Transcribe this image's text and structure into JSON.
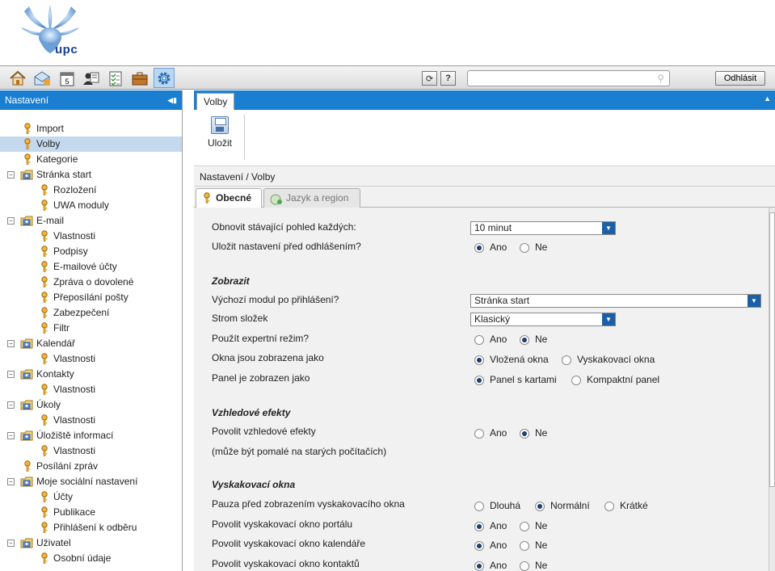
{
  "brand": {
    "logo_text": "upc"
  },
  "toolbar": {
    "icons": [
      "home-icon",
      "mail-icon",
      "calendar-icon",
      "contacts-icon",
      "tasks-icon",
      "briefcase-icon",
      "settings-gear-icon"
    ],
    "calendar_day": "5",
    "refresh_symbol": "⟳",
    "help_symbol": "?",
    "search_placeholder": "",
    "logout_label": "Odhlásit"
  },
  "sidebar": {
    "title": "Nastavení",
    "items": [
      {
        "label": "Import",
        "icon": "key-icon",
        "level": 0
      },
      {
        "label": "Volby",
        "icon": "key-icon",
        "level": 0,
        "selected": true
      },
      {
        "label": "Kategorie",
        "icon": "key-icon",
        "level": 0
      },
      {
        "label": "Stránka start",
        "icon": "folder-icon",
        "level": 0,
        "expanded": true
      },
      {
        "label": "Rozložení",
        "icon": "key-icon",
        "level": 1
      },
      {
        "label": "UWA moduly",
        "icon": "key-icon",
        "level": 1
      },
      {
        "label": "E-mail",
        "icon": "folder-icon",
        "level": 0,
        "expanded": true
      },
      {
        "label": "Vlastnosti",
        "icon": "key-icon",
        "level": 1
      },
      {
        "label": "Podpisy",
        "icon": "key-icon",
        "level": 1
      },
      {
        "label": "E-mailové účty",
        "icon": "key-icon",
        "level": 1
      },
      {
        "label": "Zpráva o dovolené",
        "icon": "key-icon",
        "level": 1
      },
      {
        "label": "Přeposílání pošty",
        "icon": "key-icon",
        "level": 1
      },
      {
        "label": "Zabezpečení",
        "icon": "key-icon",
        "level": 1
      },
      {
        "label": "Filtr",
        "icon": "key-icon",
        "level": 1
      },
      {
        "label": "Kalendář",
        "icon": "folder-icon",
        "level": 0,
        "expanded": true
      },
      {
        "label": "Vlastnosti",
        "icon": "key-icon",
        "level": 1
      },
      {
        "label": "Kontakty",
        "icon": "folder-icon",
        "level": 0,
        "expanded": true
      },
      {
        "label": "Vlastnosti",
        "icon": "key-icon",
        "level": 1
      },
      {
        "label": "Úkoly",
        "icon": "folder-icon",
        "level": 0,
        "expanded": true
      },
      {
        "label": "Vlastnosti",
        "icon": "key-icon",
        "level": 1
      },
      {
        "label": "Úložiště informací",
        "icon": "folder-icon",
        "level": 0,
        "expanded": true
      },
      {
        "label": "Vlastnosti",
        "icon": "key-icon",
        "level": 1
      },
      {
        "label": "Posílání zpráv",
        "icon": "key-icon",
        "level": 0
      },
      {
        "label": "Moje sociální nastavení",
        "icon": "folder-icon",
        "level": 0,
        "expanded": true
      },
      {
        "label": "Účty",
        "icon": "key-icon",
        "level": 1
      },
      {
        "label": "Publikace",
        "icon": "key-icon",
        "level": 1
      },
      {
        "label": "Přihlášení k odběru",
        "icon": "key-icon",
        "level": 1
      },
      {
        "label": "Uživatel",
        "icon": "folder-icon",
        "level": 0,
        "expanded": true
      },
      {
        "label": "Osobní údaje",
        "icon": "key-icon",
        "level": 1
      }
    ]
  },
  "main": {
    "tab_label": "Volby",
    "save_label": "Uložit",
    "breadcrumb": "Nastavení / Volby",
    "subtabs": {
      "general": "Obecné",
      "language": "Jazyk a region"
    },
    "form": {
      "refresh_label": "Obnovit stávající pohled každých:",
      "refresh_value": "10 minut",
      "save_settings_label": "Uložit nastavení před odhlášením?",
      "yes": "Ano",
      "no": "Ne",
      "section_display": "Zobrazit",
      "default_module_label": "Výchozí modul po přihlášení?",
      "default_module_value": "Stránka start",
      "folder_tree_label": "Strom složek",
      "folder_tree_value": "Klasický",
      "expert_mode_label": "Použít expertní režim?",
      "windows_label": "Okna jsou zobrazena jako",
      "windows_embedded": "Vložená okna",
      "windows_popup": "Vyskakovací okna",
      "panel_label": "Panel je zobrazen jako",
      "panel_tabs": "Panel s kartami",
      "panel_compact": "Kompaktní panel",
      "section_effects": "Vzhledové efekty",
      "effects_label": "Povolit vzhledové efekty",
      "effects_note": "(může být pomalé na starých počítačích)",
      "section_popups": "Vyskakovací okna",
      "popup_pause_label": "Pauza před zobrazením vyskakovacího okna",
      "pause_long": "Dlouhá",
      "pause_normal": "Normální",
      "pause_short": "Krátké",
      "popup_portal_label": "Povolit vyskakovací okno portálu",
      "popup_calendar_label": "Povolit vyskakovací okno kalendáře",
      "popup_contacts_label": "Povolit vyskakovací okno kontaktů"
    }
  }
}
